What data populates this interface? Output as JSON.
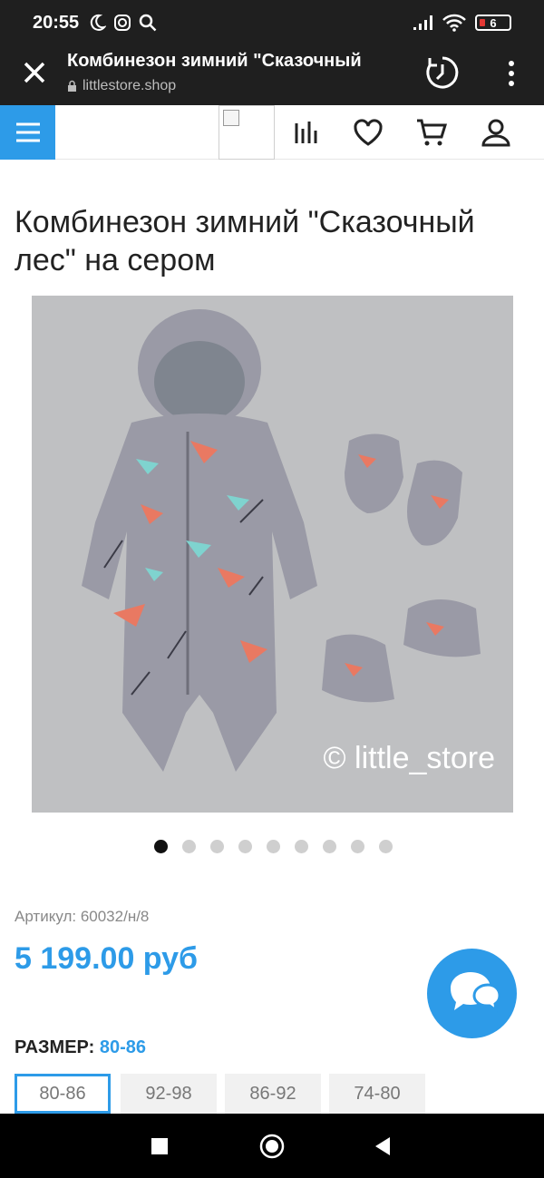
{
  "status": {
    "time": "20:55",
    "battery": "6"
  },
  "browser": {
    "page_title": "Комбинезон зимний \"Сказочный",
    "host": "littlestore.shop"
  },
  "product": {
    "title": "Комбинезон зимний \"Сказочный лес\" на сером",
    "watermark": "© little_store",
    "sku": "Артикул: 60032/н/8",
    "price": "5 199.00 руб",
    "size_label": "РАЗМЕР:",
    "size_selected": "80-86",
    "sizes": [
      "80-86",
      "92-98",
      "86-92",
      "74-80"
    ]
  },
  "colors": {
    "accent": "#2d9be8",
    "dark": "#1f1f1f"
  }
}
